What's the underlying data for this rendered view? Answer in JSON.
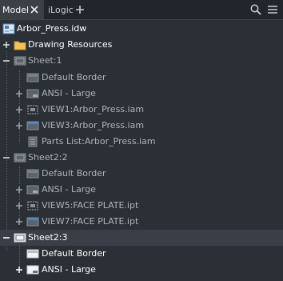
{
  "tabs": {
    "model_label": "Model",
    "ilogic_label": "iLogic"
  },
  "tree": {
    "root_label": "Arbor_Press.idw",
    "drawing_resources": "Drawing Resources",
    "sheet1": {
      "label": "Sheet:1",
      "children": [
        "Default Border",
        "ANSI - Large",
        "VIEW1:Arbor_Press.iam",
        "VIEW3:Arbor_Press.iam",
        "Parts List:Arbor_Press.iam"
      ]
    },
    "sheet2": {
      "label": "Sheet2:2",
      "children": [
        "Default Border",
        "ANSI - Large",
        "VIEW5:FACE PLATE.ipt",
        "VIEW7:FACE PLATE.ipt"
      ]
    },
    "sheet3": {
      "label": "Sheet2:3",
      "children": [
        "Default Border",
        "ANSI - Large"
      ]
    }
  },
  "colors": {
    "background": "#2b2f36",
    "tab_active": "#3b4047",
    "selected_row": "#3a3f47",
    "text_dim": "#aeb4bb",
    "text_bright": "#ffffff"
  }
}
